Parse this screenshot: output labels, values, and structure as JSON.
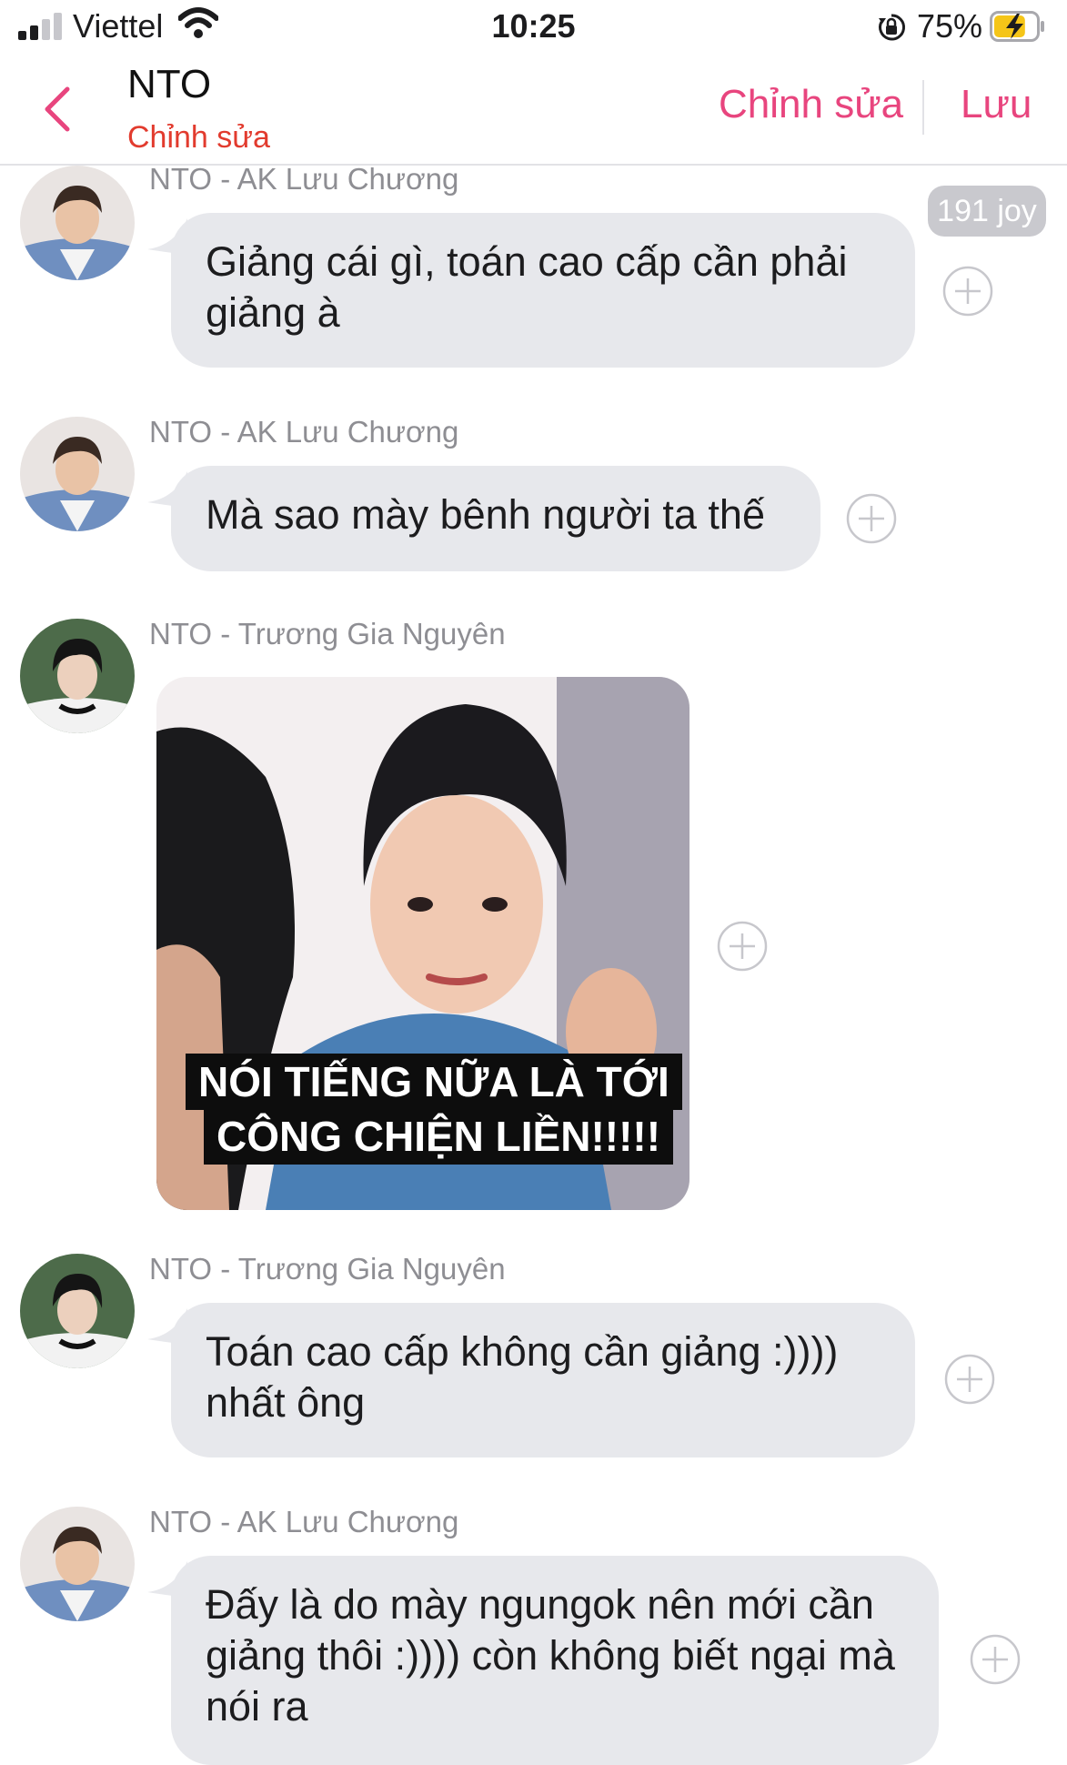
{
  "status_bar": {
    "carrier": "Viettel",
    "time": "10:25",
    "battery_percent": "75%",
    "battery_level": 0.75,
    "charging": true,
    "icons": [
      "signal-icon",
      "wifi-icon",
      "rotation-lock-icon",
      "battery-charging-icon"
    ]
  },
  "nav": {
    "title": "NTO",
    "subtitle": "Chỉnh sửa",
    "edit_label": "Chỉnh sửa",
    "save_label": "Lưu",
    "back_icon": "chevron-left-icon",
    "accent_color": "#e8457e",
    "subtitle_color": "#e23b2e"
  },
  "messages": [
    {
      "sender": "NTO - AK Lưu Chương",
      "type": "text",
      "text": "Giảng cái gì, toán cao cấp cần phải giảng à",
      "reaction_badge": "191 joy",
      "avatar": "avatar-luu-chuong"
    },
    {
      "sender": "NTO - AK Lưu Chương",
      "type": "text",
      "text": "Mà sao mày bênh người ta thế",
      "avatar": "avatar-luu-chuong"
    },
    {
      "sender": "NTO - Trương Gia Nguyên",
      "type": "image",
      "image_caption_line1": "NÓI TIẾNG NỮA LÀ TỚI",
      "image_caption_line2": "CÔNG CHIỆN LIỀN!!!!!",
      "avatar": "avatar-truong-gia-nguyen"
    },
    {
      "sender": "NTO - Trương Gia Nguyên",
      "type": "text",
      "text": "Toán cao cấp không cần giảng :)))) nhất ông",
      "avatar": "avatar-truong-gia-nguyen"
    },
    {
      "sender": "NTO - AK Lưu Chương",
      "type": "text",
      "text": "Đấy là do mày ngungok nên mới cần giảng thôi :)))) còn không biết ngại mà nói ra",
      "avatar": "avatar-luu-chuong"
    }
  ],
  "colors": {
    "bubble": "#e7e8ec",
    "sender": "#8e8e93",
    "plus": "#c7c7cc"
  }
}
